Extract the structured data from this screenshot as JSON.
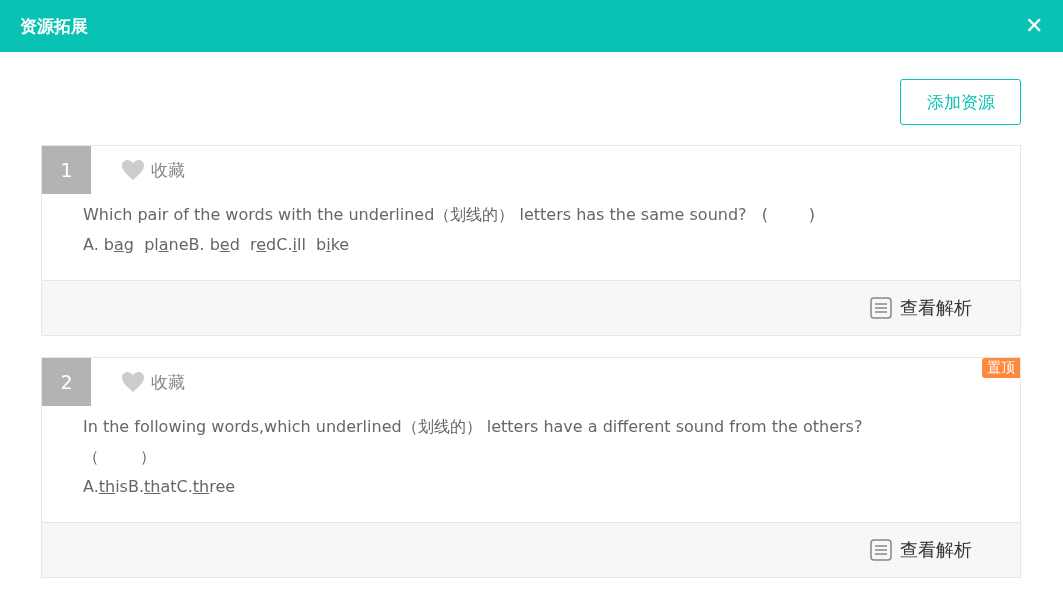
{
  "dialog": {
    "title": "资源拓展",
    "close": "✕"
  },
  "add_button": "添加资源",
  "questions": [
    {
      "number": "1",
      "favorite_label": "收藏",
      "favorited": false,
      "pinned": false,
      "question_lines": [
        "Which pair of the words with the underlined（划线的） letters has the same sound?   (        )"
      ],
      "options": [
        {
          "text": "A. b",
          "underline": false
        },
        {
          "text": "a",
          "underline": true
        },
        {
          "text": "g  pl",
          "underline": false
        },
        {
          "text": "a",
          "underline": true
        },
        {
          "text": "neB. b",
          "underline": false
        },
        {
          "text": "e",
          "underline": true
        },
        {
          "text": "d  r",
          "underline": false
        },
        {
          "text": "e",
          "underline": true
        },
        {
          "text": "dC.",
          "underline": false
        },
        {
          "text": "i",
          "underline": true
        },
        {
          "text": "ll  b",
          "underline": false
        },
        {
          "text": "i",
          "underline": true
        },
        {
          "text": "ke",
          "underline": false
        }
      ],
      "analysis_label": "查看解析"
    },
    {
      "number": "2",
      "favorite_label": "收藏",
      "favorited": false,
      "pinned": true,
      "pin_label": "置顶",
      "question_lines": [
        "In the following words,which underlined（划线的） letters have a different sound from the others?",
        "（        ）"
      ],
      "options": [
        {
          "text": "A.",
          "underline": false
        },
        {
          "text": "th",
          "underline": true
        },
        {
          "text": "isB.",
          "underline": false
        },
        {
          "text": "th",
          "underline": true
        },
        {
          "text": "atC.",
          "underline": false
        },
        {
          "text": "th",
          "underline": true
        },
        {
          "text": "ree",
          "underline": false
        }
      ],
      "analysis_label": "查看解析"
    }
  ]
}
